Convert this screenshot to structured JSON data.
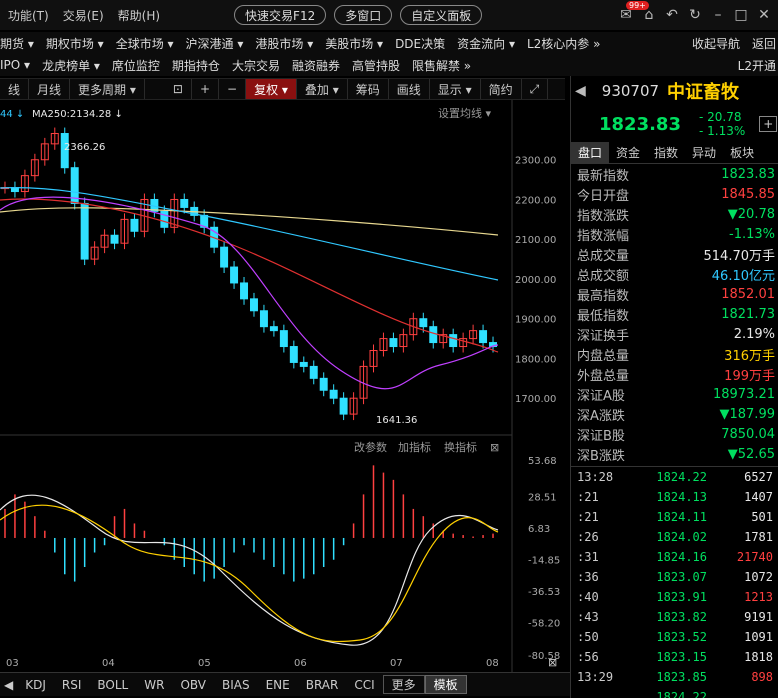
{
  "topbar": {
    "menus": [
      "功能(T)",
      "交易(E)",
      "帮助(H)"
    ],
    "quick_trade": "快速交易F12",
    "multi_window": "多窗口",
    "custom_panel": "自定义面板",
    "badge": "99+"
  },
  "nav1": [
    "期货 ▾",
    "期权市场 ▾",
    "全球市场 ▾",
    "沪深港通 ▾",
    "港股市场 ▾",
    "美股市场 ▾",
    "DDE决策",
    "资金流向 ▾",
    "L2核心内参 »",
    "收起导航",
    "返回"
  ],
  "nav2": [
    "IPO ▾",
    "龙虎榜单 ▾",
    "席位监控",
    "期指持仓",
    "大宗交易",
    "融资融券",
    "高管持股",
    "限售解禁 »",
    "L2开通"
  ],
  "toolbar": {
    "period_line": "线",
    "month_line": "月线",
    "more_period": "更多周期 ▾",
    "restore": "复权 ▾",
    "overlay": "叠加 ▾",
    "chips": "筹码",
    "draw": "画线",
    "display": "显示 ▾",
    "simple": "简约"
  },
  "chart": {
    "ma_label": "MA250:2134.28 ↓",
    "ma_prefix": "44 ↓",
    "set_ma": "设置均线 ▾",
    "high_label": "2366.26",
    "low_label": "1641.36",
    "price_ticks": [
      "2300.00",
      "2200.00",
      "2100.00",
      "2000.00",
      "1900.00",
      "1800.00",
      "1700.00"
    ],
    "macd_ticks": [
      "53.68",
      "28.51",
      "6.83",
      "-14.85",
      "-36.53",
      "-58.20",
      "-80.58"
    ],
    "macd_tools": [
      "改参数",
      "加指标",
      "换指标"
    ],
    "months": [
      "03",
      "04",
      "05",
      "06",
      "07",
      "08"
    ]
  },
  "chart_data": {
    "type": "candlestick",
    "price_range": [
      1620,
      2400
    ],
    "ma250": 2134.28,
    "high": 2366.26,
    "low": 1641.36,
    "closes": [
      2230,
      2220,
      2260,
      2300,
      2340,
      2366,
      2280,
      2190,
      2050,
      2080,
      2110,
      2090,
      2150,
      2120,
      2200,
      2170,
      2130,
      2200,
      2180,
      2160,
      2130,
      2080,
      2030,
      1990,
      1950,
      1920,
      1880,
      1870,
      1830,
      1790,
      1780,
      1750,
      1720,
      1700,
      1660,
      1700,
      1780,
      1820,
      1850,
      1830,
      1860,
      1900,
      1880,
      1840,
      1860,
      1830,
      1850,
      1870,
      1840,
      1830
    ],
    "macd_range": [
      -80.58,
      53.68
    ],
    "macd_bars": [
      20,
      30,
      25,
      15,
      5,
      -10,
      -25,
      -30,
      -20,
      -10,
      -5,
      15,
      20,
      10,
      5,
      0,
      -5,
      -15,
      -20,
      -25,
      -30,
      -28,
      -20,
      -10,
      -5,
      -10,
      -15,
      -20,
      -25,
      -30,
      -28,
      -25,
      -20,
      -15,
      -5,
      10,
      30,
      50,
      45,
      40,
      30,
      20,
      15,
      10,
      5,
      3,
      2,
      1,
      2,
      3
    ]
  },
  "rpanel": {
    "code": "930707",
    "name": "中证畜牧",
    "price": "1823.83",
    "change": "- 20.78",
    "pct": "- 1.13%",
    "tabs": [
      "盘口",
      "资金",
      "指数",
      "异动",
      "板块"
    ],
    "quotes": [
      [
        "最新指数",
        "1823.83",
        "green"
      ],
      [
        "今日开盘",
        "1845.85",
        "red"
      ],
      [
        "指数涨跌",
        "▼20.78",
        "green"
      ],
      [
        "指数涨幅",
        "-1.13%",
        "green"
      ],
      [
        "总成交量",
        "514.70万手",
        "white"
      ],
      [
        "总成交额",
        "46.10亿元",
        "cyan"
      ],
      [
        "最高指数",
        "1852.01",
        "red"
      ],
      [
        "最低指数",
        "1821.73",
        "green"
      ],
      [
        "深证换手",
        "2.19%",
        "white"
      ],
      [
        "内盘总量",
        "316万手",
        "yellow"
      ],
      [
        "外盘总量",
        "199万手",
        "red"
      ],
      [
        "深证A股",
        "18973.21",
        "green"
      ],
      [
        "深A涨跌",
        "▼187.99",
        "green"
      ],
      [
        "深证B股",
        "7850.04",
        "green"
      ],
      [
        "深B涨跌",
        "▼52.65",
        "green"
      ]
    ],
    "ticks": [
      [
        "13:28",
        "1824.22",
        "6527",
        "white"
      ],
      [
        ":21",
        "1824.13",
        "1407",
        "white"
      ],
      [
        ":21",
        "1824.11",
        "501",
        "white"
      ],
      [
        ":26",
        "1824.02",
        "1781",
        "white"
      ],
      [
        ":31",
        "1824.16",
        "21740",
        "red"
      ],
      [
        ":36",
        "1823.07",
        "1072",
        "white"
      ],
      [
        ":40",
        "1823.91",
        "1213",
        "red"
      ],
      [
        ":43",
        "1823.82",
        "9191",
        "white"
      ],
      [
        ":50",
        "1823.52",
        "1091",
        "white"
      ],
      [
        ":56",
        "1823.15",
        "1818",
        "white"
      ],
      [
        "13:29",
        "1823.85",
        "898",
        "red"
      ],
      [
        "",
        "1824.22",
        "",
        "white"
      ]
    ]
  },
  "bottombar": [
    "KDJ",
    "RSI",
    "BOLL",
    "WR",
    "OBV",
    "BIAS",
    "ENE",
    "BRAR",
    "CCI",
    "更多",
    "模板"
  ]
}
